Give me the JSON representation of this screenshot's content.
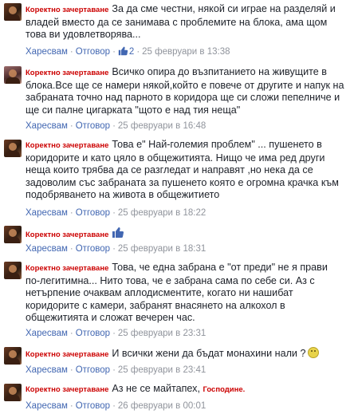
{
  "author": "Коректно зачертаване",
  "actions": {
    "like": "Харесвам",
    "reply": "Отговор",
    "separator": "·"
  },
  "comments": [
    {
      "text": "За да сме честни, някой си играе на разделяй и владей вместо да се занимава с проблемите на блока, ама щом това ви удовлетворява...",
      "likes": "2",
      "date": "25 февруари в 13:38"
    },
    {
      "text": "Всичко опира до възпитанието на живущите в блока.Все ще се намери някой,който е повече от другите и напук на забраната точно над парното в коридора ще си сложи пепелниче и ще си палне цигарката \"щото е над тия неща\"",
      "date": "25 февруари в 16:48"
    },
    {
      "text": "Това е\" Най-големия проблем\" ... пушенето в коридорите и като цяло в общежитията. Нищо че има ред други неща които трябва да се разгледат и направят ,но нека да се задоволим със забраната за пушенето която е огромна крачка към подобряването на живота в общежитието",
      "date": "25 февруари в 18:22"
    },
    {
      "text": "",
      "date": "25 февруари в 18:31"
    },
    {
      "text": "Това, че една забрана е \"от преди\" не я прави по-легитимна... Нито това, че е забрана сама по себе си. Аз с нетърпение очаквам аплодисментите, когато ни нашибат коридорите с камери, забранят внасянето на алкохол в общежитията и сложат вечерен час.",
      "date": "25 февруари в 23:31"
    },
    {
      "text": "И всички жени да бъдат монахини нали ?",
      "date": "25 февруари в 23:41"
    },
    {
      "text": "Аз не се майтапех,",
      "suffix": "Господине.",
      "date": "26 февруари в 00:01"
    }
  ]
}
